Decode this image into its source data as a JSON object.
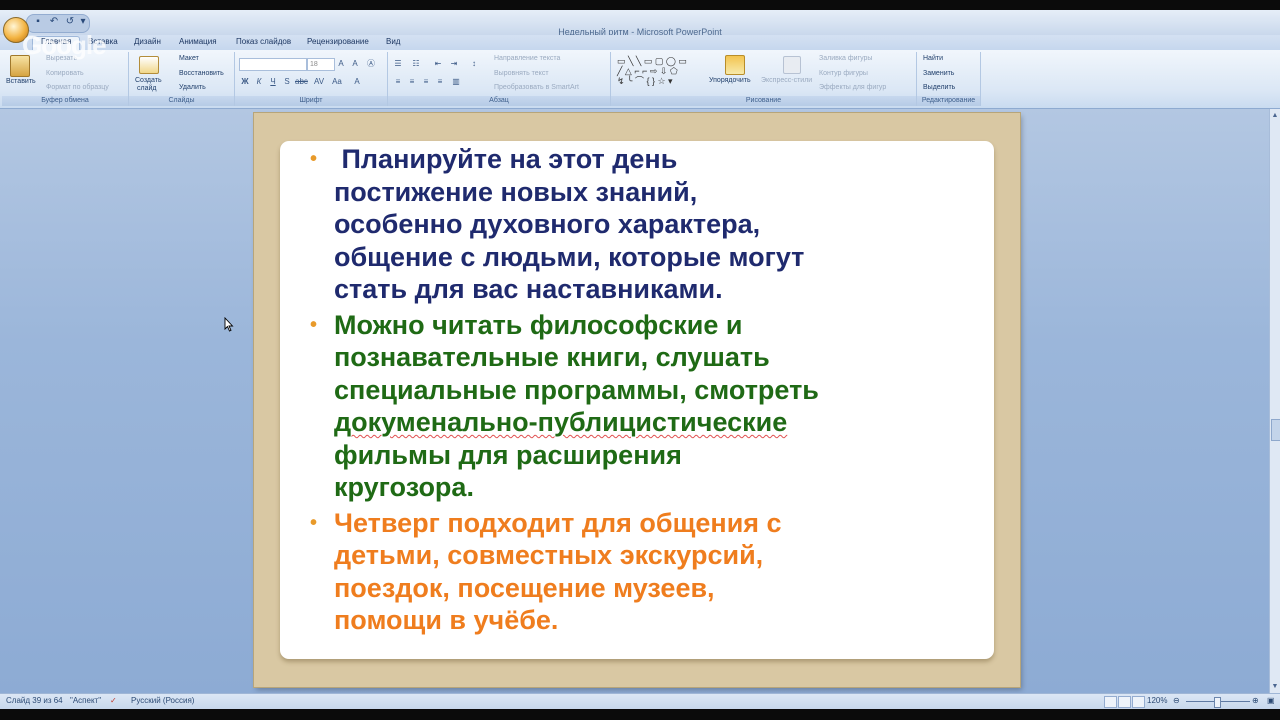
{
  "window": {
    "title": "Недельный ритм - Microsoft PowerPoint",
    "watermark": "Google"
  },
  "quick_access": [
    "save-icon",
    "undo-icon",
    "redo-icon",
    "dropdown-icon"
  ],
  "tabs": [
    {
      "label": "Главная",
      "active": true
    },
    {
      "label": "Вставка"
    },
    {
      "label": "Дизайн"
    },
    {
      "label": "Анимация"
    },
    {
      "label": "Показ слайдов"
    },
    {
      "label": "Рецензирование"
    },
    {
      "label": "Вид"
    }
  ],
  "ribbon": {
    "clipboard": {
      "label": "Буфер обмена",
      "paste": "Вставить",
      "cut": "Вырезать",
      "copy": "Копировать",
      "format_painter": "Формат по образцу"
    },
    "slides": {
      "label": "Слайды",
      "new_slide_1": "Создать",
      "new_slide_2": "слайд",
      "layout": "Макет",
      "reset": "Восстановить",
      "delete": "Удалить"
    },
    "font": {
      "label": "Шрифт",
      "font_name": "",
      "font_size": "18"
    },
    "paragraph": {
      "label": "Абзац",
      "text_direction": "Направление текста",
      "align_text": "Выровнять текст",
      "smartart": "Преобразовать в SmartArt"
    },
    "drawing": {
      "label": "Рисование",
      "arrange": "Упорядочить",
      "quick_styles": "Экспресс-стили",
      "shape_fill": "Заливка фигуры",
      "shape_outline": "Контур фигуры",
      "shape_effects": "Эффекты для фигур"
    },
    "editing": {
      "label": "Редактирование",
      "find": "Найти",
      "replace": "Заменить",
      "select": "Выделить"
    }
  },
  "slide": {
    "bullets": [
      {
        "lines": [
          " Планируйте на этот день",
          "постижение новых знаний,",
          "особенно духовного характера,",
          "общение с людьми, которые могут",
          "стать для вас наставниками."
        ],
        "color": "#1f2a6e"
      },
      {
        "lines": [
          "Можно читать философские и",
          "познавательные книги, слушать",
          "специальные программы, смотреть",
          "докуменально-публицистические",
          "фильмы для расширения",
          "кругозора."
        ],
        "color": "#1f6a15"
      },
      {
        "lines": [
          "Четверг подходит для общения с",
          "детьми, совместных экскурсий,",
          "поездок, посещение музеев,",
          "помощи в учёбе."
        ],
        "color": "#ef7d1e"
      }
    ],
    "bullet_color": "#e89a2a"
  },
  "status": {
    "slide_counter": "Слайд 39 из 64",
    "theme": "\"Аспект\"",
    "language": "Русский (Россия)",
    "zoom": "120%"
  }
}
